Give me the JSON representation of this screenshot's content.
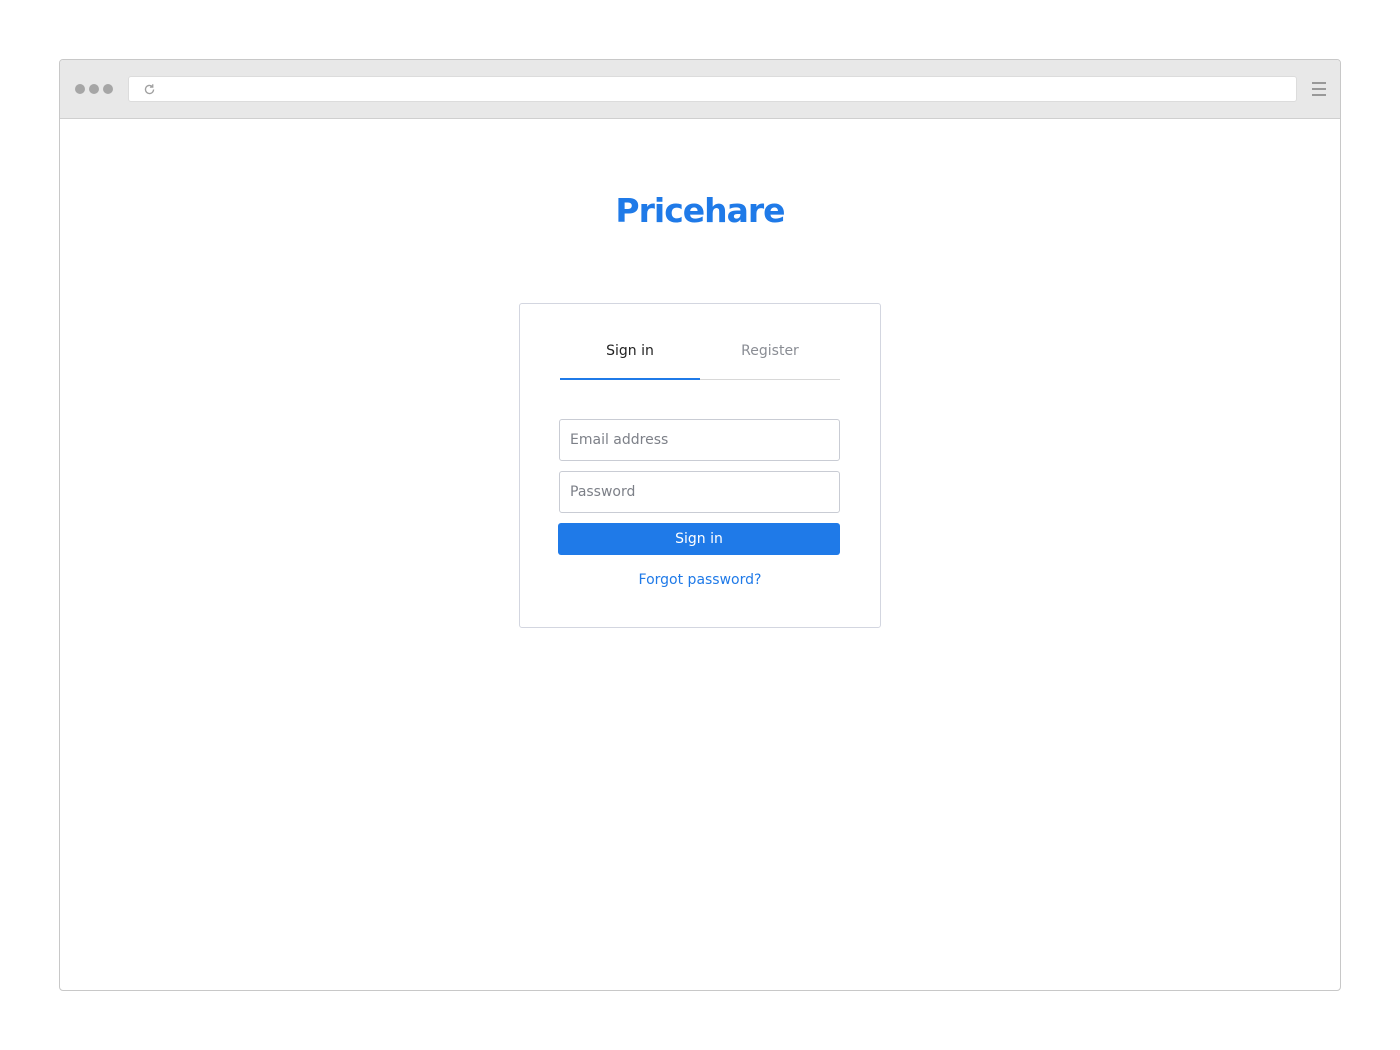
{
  "browser": {
    "icons": {
      "reload": "reload-icon",
      "menu": "hamburger-menu-icon"
    }
  },
  "brand": {
    "name": "Pricehare"
  },
  "auth": {
    "tabs": [
      {
        "label": "Sign in",
        "active": true
      },
      {
        "label": "Register",
        "active": false
      }
    ],
    "email": {
      "placeholder": "Email address",
      "value": ""
    },
    "password": {
      "placeholder": "Password",
      "value": ""
    },
    "submit_label": "Sign in",
    "forgot_label": "Forgot password?"
  },
  "colors": {
    "accent": "#1f7ae8",
    "tab_inactive": "#8a8d94",
    "placeholder": "#7d8088",
    "card_border": "#d3d6e0"
  }
}
